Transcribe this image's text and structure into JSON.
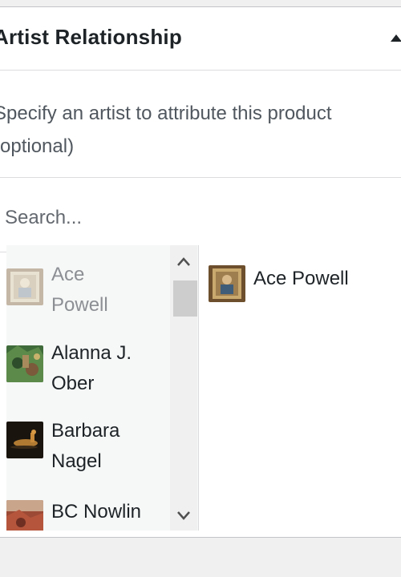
{
  "panel": {
    "title": "Artist Relationship",
    "collapse_icon": "triangle-up-icon",
    "description_lines": [
      "Specify an artist to attribute this product",
      "(optional)"
    ]
  },
  "search": {
    "placeholder": "Search...",
    "value": ""
  },
  "choices": {
    "items": [
      {
        "name_lines": [
          "Ace",
          "Powell"
        ],
        "disabled": true,
        "thumb": "painting-portrait-thumbnail"
      },
      {
        "name_lines": [
          "Alanna J.",
          "Ober"
        ],
        "disabled": false,
        "thumb": "painting-green-thumbnail"
      },
      {
        "name_lines": [
          "Barbara",
          "Nagel"
        ],
        "disabled": false,
        "thumb": "sculpture-thumbnail"
      },
      {
        "name_lines": [
          "BC Nowlin"
        ],
        "disabled": false,
        "thumb": "painting-red-thumbnail"
      }
    ],
    "scroll_up_icon": "chevron-up-icon",
    "scroll_down_icon": "chevron-down-icon"
  },
  "selected": {
    "items": [
      {
        "name": "Ace Powell",
        "thumb": "painting-portrait-thumbnail"
      }
    ]
  }
}
